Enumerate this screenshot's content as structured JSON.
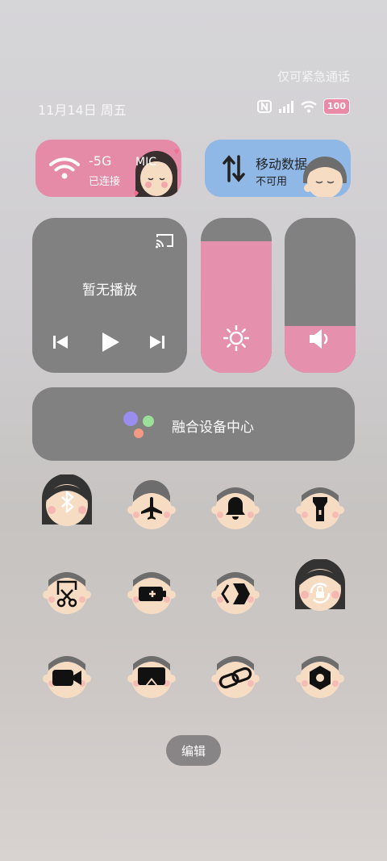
{
  "status_bar": {
    "emergency_text": "仅可紧急通话",
    "date_text": "11月14日 周五",
    "battery_level": "100",
    "icons": [
      "nfc-icon",
      "signal-icon",
      "wifi-icon",
      "battery-icon"
    ]
  },
  "tiles": {
    "wifi": {
      "title": "-5G",
      "subtitle": "已连接",
      "avatar_text": "MIC",
      "icon": "wifi-icon"
    },
    "mobile_data": {
      "title": "移动数据",
      "subtitle": "不可用",
      "icon": "data-arrows-icon"
    },
    "media": {
      "label": "暂无播放",
      "icons": [
        "cast-icon",
        "previous-icon",
        "play-icon",
        "next-icon"
      ]
    },
    "brightness": {
      "icon": "sun-icon",
      "level_fraction": 0.85
    },
    "volume": {
      "icon": "speaker-icon",
      "level_fraction": 0.3
    },
    "fusion": {
      "label": "融合设备中心",
      "icon": "fusion-dots-icon"
    }
  },
  "toggles": [
    {
      "name": "bluetooth",
      "icon": "bluetooth-icon",
      "active": true
    },
    {
      "name": "airplane",
      "icon": "airplane-icon",
      "active": false
    },
    {
      "name": "bell",
      "icon": "bell-icon",
      "active": false
    },
    {
      "name": "flashlight",
      "icon": "flashlight-icon",
      "active": false
    },
    {
      "name": "screenshot",
      "icon": "scissors-icon",
      "active": false
    },
    {
      "name": "battery-saver",
      "icon": "battery-plus-icon",
      "active": false
    },
    {
      "name": "share",
      "icon": "share-icon",
      "active": false
    },
    {
      "name": "rotation-lock",
      "icon": "rotation-lock-icon",
      "active": true
    },
    {
      "name": "screen-record",
      "icon": "video-camera-icon",
      "active": false
    },
    {
      "name": "screen-cast",
      "icon": "screencast-icon",
      "active": false
    },
    {
      "name": "link",
      "icon": "link-icon",
      "active": false
    },
    {
      "name": "settings",
      "icon": "hex-nut-icon",
      "active": false
    }
  ],
  "edit_button": {
    "label": "编辑"
  },
  "colors": {
    "pink": "#e58aa7",
    "blue": "#90b8e6",
    "tile_gray": "#828181",
    "face": "#f7dcc4",
    "hair_dark": "#333333",
    "hair_gray": "#6d6d6d"
  }
}
